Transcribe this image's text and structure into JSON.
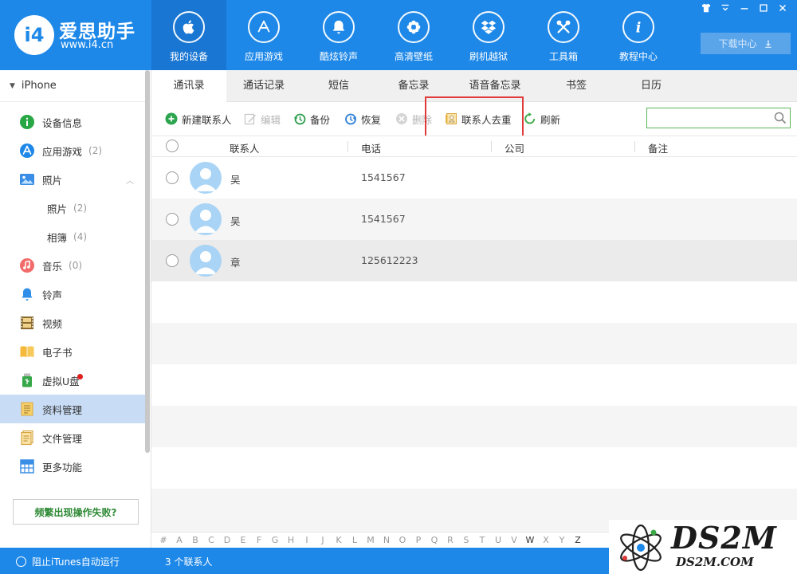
{
  "app": {
    "title": "爱思助手",
    "url": "www.i4.cn",
    "logo_text": "i4"
  },
  "nav": [
    {
      "label": "我的设备",
      "icon": "apple-icon"
    },
    {
      "label": "应用游戏",
      "icon": "app-store-icon"
    },
    {
      "label": "酷炫铃声",
      "icon": "bell-icon"
    },
    {
      "label": "高清壁纸",
      "icon": "flower-icon"
    },
    {
      "label": "刷机越狱",
      "icon": "dropbox-icon"
    },
    {
      "label": "工具箱",
      "icon": "tools-icon"
    },
    {
      "label": "教程中心",
      "icon": "info-icon"
    }
  ],
  "download_btn": "下载中心",
  "window_controls": [
    "shirt-icon",
    "menu-icon",
    "minimize-icon",
    "maximize-icon",
    "close-icon"
  ],
  "sidebar": {
    "device": "iPhone",
    "items": [
      {
        "label": "设备信息",
        "count": "",
        "icon": "info-circle-icon"
      },
      {
        "label": "应用游戏",
        "count": "(2)",
        "icon": "app-store-icon"
      },
      {
        "label": "照片",
        "count": "",
        "icon": "photo-icon"
      },
      {
        "label": "照片",
        "count": "(2)",
        "icon": ""
      },
      {
        "label": "相簿",
        "count": "(4)",
        "icon": ""
      },
      {
        "label": "音乐",
        "count": "(0)",
        "icon": "music-icon"
      },
      {
        "label": "铃声",
        "count": "",
        "icon": "bell-icon"
      },
      {
        "label": "视频",
        "count": "",
        "icon": "film-icon"
      },
      {
        "label": "电子书",
        "count": "",
        "icon": "book-icon"
      },
      {
        "label": "虚拟U盘",
        "count": "",
        "icon": "usb-icon"
      },
      {
        "label": "资料管理",
        "count": "",
        "icon": "notes-icon"
      },
      {
        "label": "文件管理",
        "count": "",
        "icon": "file-icon"
      },
      {
        "label": "更多功能",
        "count": "",
        "icon": "grid-icon"
      }
    ],
    "help_btn": "频繁出现操作失败?"
  },
  "tabs": [
    "通讯录",
    "通话记录",
    "短信",
    "备忘录",
    "语音备忘录",
    "书签",
    "日历"
  ],
  "active_tab": "通讯录",
  "toolbar": {
    "new_contact": "新建联系人",
    "edit": "编辑",
    "backup": "备份",
    "restore": "恢复",
    "delete": "删除",
    "dedupe": "联系人去重",
    "refresh": "刷新",
    "search_placeholder": ""
  },
  "table": {
    "columns": [
      "联系人",
      "电话",
      "公司",
      "备注"
    ],
    "rows": [
      {
        "name": "吴",
        "phone": "1541567",
        "company": "",
        "note": ""
      },
      {
        "name": "吴",
        "phone": "1541567",
        "company": "",
        "note": ""
      },
      {
        "name": "章",
        "phone": "125612223",
        "company": "",
        "note": ""
      }
    ]
  },
  "alphabet": [
    "#",
    "A",
    "B",
    "C",
    "D",
    "E",
    "F",
    "G",
    "H",
    "I",
    "J",
    "K",
    "L",
    "M",
    "N",
    "O",
    "P",
    "Q",
    "R",
    "S",
    "T",
    "U",
    "V",
    "W",
    "X",
    "Y",
    "Z"
  ],
  "alphabet_active": [
    "W",
    "Z"
  ],
  "status": {
    "itunes": "阻止iTunes自动运行",
    "count": "3 个联系人"
  },
  "watermark": {
    "big": "DS2M",
    "small": "DS2M.COM"
  },
  "colors": {
    "brand": "#1e88e8",
    "highlight": "#e03a3a",
    "search_border": "#5ab55a"
  }
}
